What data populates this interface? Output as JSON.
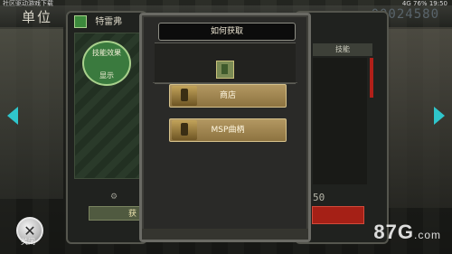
{
  "status_bar": {
    "left": "社区驱动游戏下载",
    "right_icons": "4G",
    "battery": "76%",
    "time": "19:50"
  },
  "header": {
    "title": "单位",
    "score": "00024580"
  },
  "character": {
    "name": "特雷弗",
    "badge_line1": "技能效果",
    "badge_line2": "显示",
    "bottom_button": "获"
  },
  "skills": {
    "tab_label": "技能",
    "value": "50"
  },
  "modal": {
    "title": "如何获取",
    "options": [
      {
        "label": "商店"
      },
      {
        "label": "MSP曲柄"
      }
    ]
  },
  "close": {
    "label": "关闭"
  },
  "watermark": {
    "text": "87G",
    "suffix": ".com"
  },
  "colors": {
    "accent_cyan": "#2fc6cc",
    "button_gold": "#b39862",
    "alert_red": "#a52016"
  }
}
